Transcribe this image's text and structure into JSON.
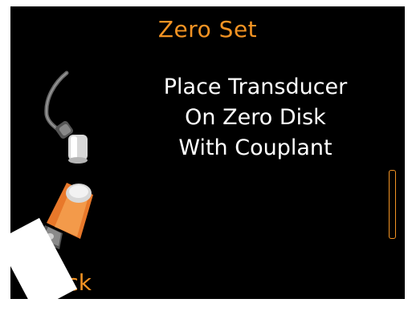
{
  "screen": {
    "title": "Zero Set",
    "instruction_lines": [
      "Place Transducer",
      "On Zero Disk",
      "With Couplant"
    ],
    "back_label": "Back"
  },
  "colors": {
    "background": "#000000",
    "accent": "#f39323",
    "text": "#ffffff"
  },
  "icons": {
    "transducer": "transducer-icon",
    "zero_disk": "zero-disk-icon",
    "scrollbar": "scrollbar"
  }
}
